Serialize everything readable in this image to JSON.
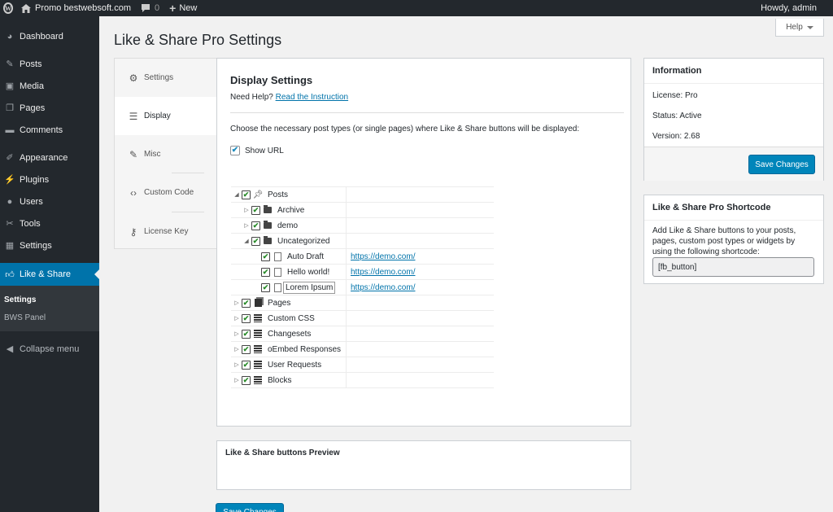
{
  "adminbar": {
    "site_name": "Promo bestwebsoft.com",
    "comments_count": "0",
    "new_label": "New",
    "howdy": "Howdy, admin"
  },
  "sidebar": {
    "items": [
      {
        "label": "Dashboard",
        "icon": "dashboard-icon"
      },
      {
        "label": "Posts",
        "icon": "pin-icon"
      },
      {
        "label": "Media",
        "icon": "media-icon"
      },
      {
        "label": "Pages",
        "icon": "pages-icon"
      },
      {
        "label": "Comments",
        "icon": "comment-icon"
      },
      {
        "label": "Appearance",
        "icon": "brush-icon"
      },
      {
        "label": "Plugins",
        "icon": "plug-icon"
      },
      {
        "label": "Users",
        "icon": "users-icon"
      },
      {
        "label": "Tools",
        "icon": "wrench-icon"
      },
      {
        "label": "Settings",
        "icon": "settings-icon"
      },
      {
        "label": "Like & Share",
        "icon": "thumbs-up-icon"
      }
    ],
    "submenu": [
      "Settings",
      "BWS Panel"
    ],
    "collapse": "Collapse menu"
  },
  "page": {
    "title": "Like & Share Pro Settings",
    "help": "Help"
  },
  "tabs": [
    "Settings",
    "Display",
    "Misc",
    "Custom Code",
    "License Key"
  ],
  "display": {
    "heading": "Display Settings",
    "need_help": "Need Help?",
    "instruction_link": "Read the Instruction",
    "choose_text": "Choose the necessary post types (or single pages) where Like & Share buttons will be displayed:",
    "show_url": "Show URL"
  },
  "tree": [
    {
      "label": "Posts",
      "url": ""
    },
    {
      "label": "Archive",
      "url": ""
    },
    {
      "label": "demo",
      "url": ""
    },
    {
      "label": "Uncategorized",
      "url": ""
    },
    {
      "label": "Auto Draft",
      "url": "https://demo.com/"
    },
    {
      "label": "Hello world!",
      "url": "https://demo.com/"
    },
    {
      "label": "Lorem Ipsum",
      "url": "https://demo.com/"
    },
    {
      "label": "Pages",
      "url": ""
    },
    {
      "label": "Custom CSS",
      "url": ""
    },
    {
      "label": "Changesets",
      "url": ""
    },
    {
      "label": "oEmbed Responses",
      "url": ""
    },
    {
      "label": "User Requests",
      "url": ""
    },
    {
      "label": "Blocks",
      "url": ""
    }
  ],
  "info": {
    "title": "Information",
    "license": "License: Pro",
    "status": "Status: Active",
    "version": "Version: 2.68",
    "save": "Save Changes"
  },
  "shortcode": {
    "title": "Like & Share Pro Shortcode",
    "description": "Add Like & Share buttons to your posts, pages, custom post types or widgets by using the following shortcode:",
    "value": "[fb_button]"
  },
  "preview": {
    "title": "Like & Share buttons Preview"
  },
  "save_main": "Save Changes"
}
